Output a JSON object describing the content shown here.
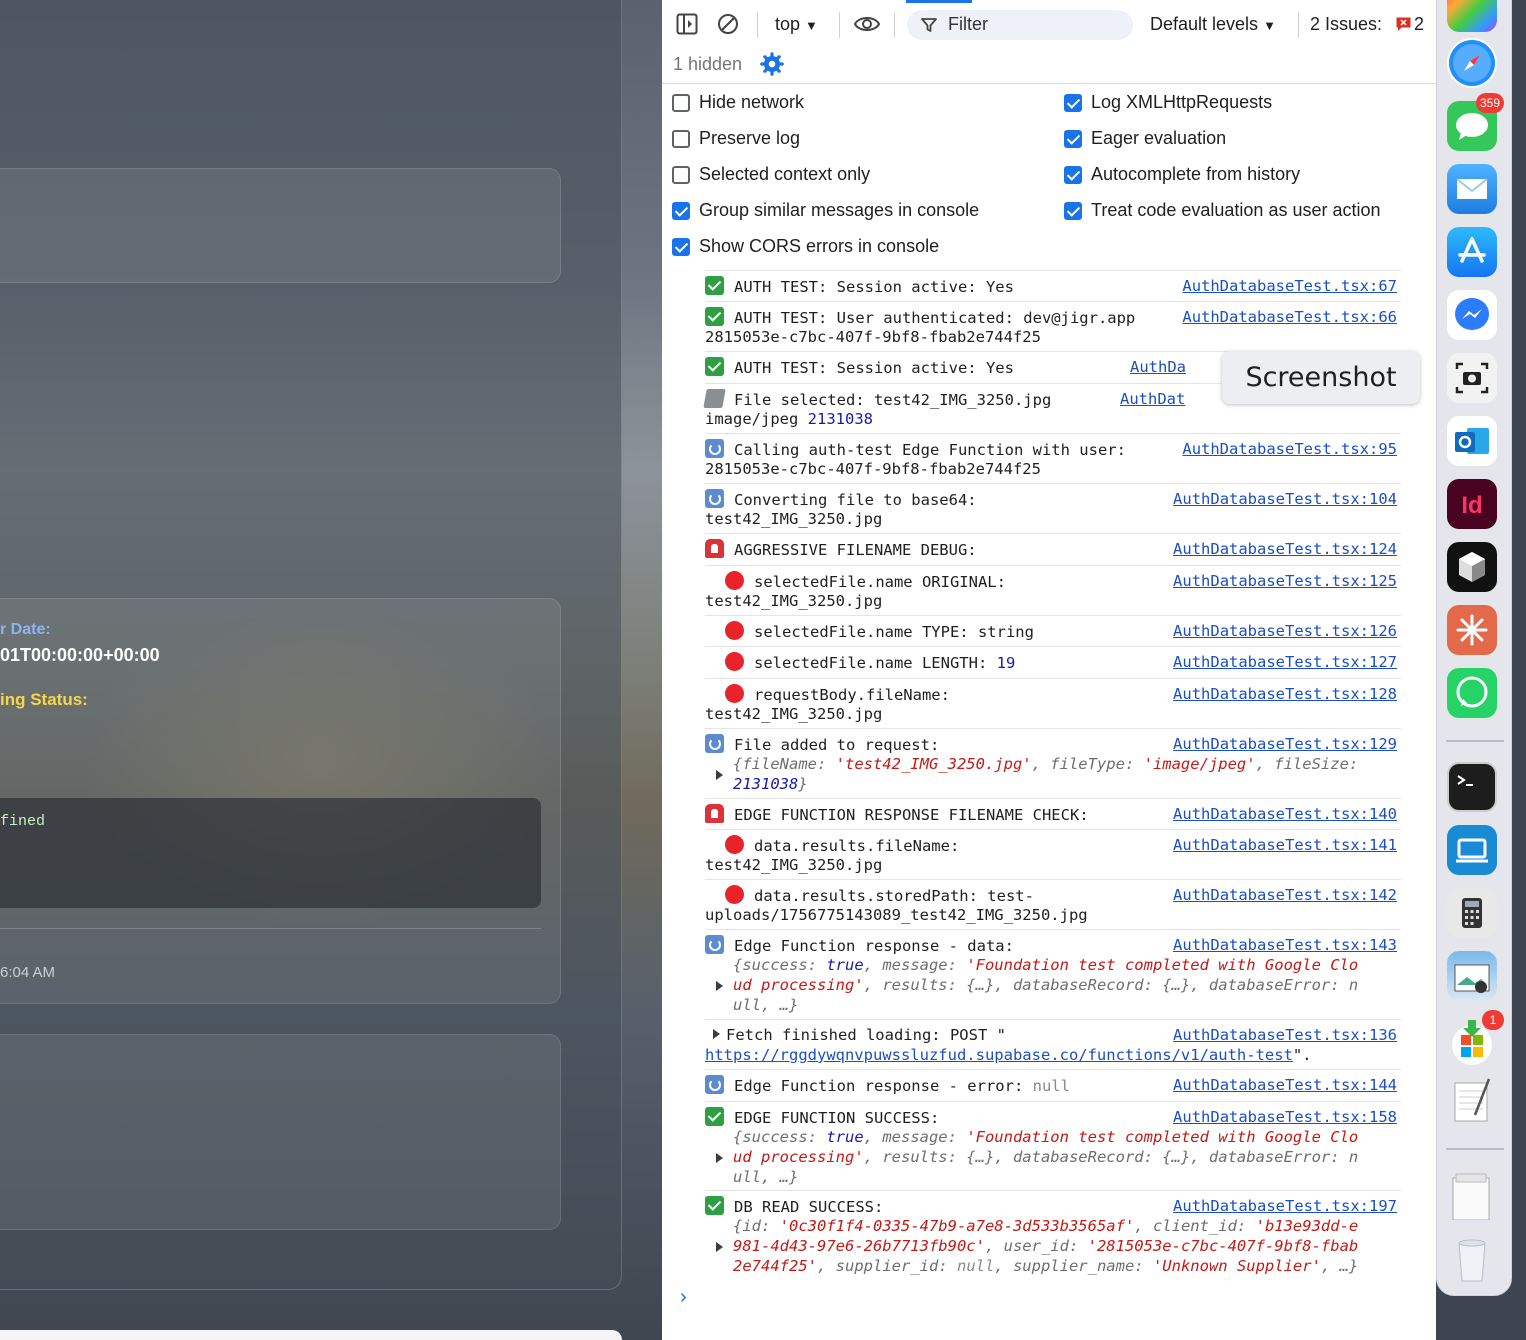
{
  "app": {
    "date_label": "r Date:",
    "date_value": "01T00:00:00+00:00",
    "status_label": "ing Status:",
    "code_snippet": "fined",
    "timestamp": "6:04 AM"
  },
  "devtools": {
    "toolbar": {
      "context": "top",
      "filter_placeholder": "Filter",
      "levels": "Default levels",
      "issues_label": "2 Issues:",
      "issues_count": "2"
    },
    "hidden_count": "1 hidden",
    "settings": {
      "left": [
        {
          "label": "Hide network",
          "checked": false
        },
        {
          "label": "Preserve log",
          "checked": false
        },
        {
          "label": "Selected context only",
          "checked": false
        },
        {
          "label": "Group similar messages in console",
          "checked": true
        },
        {
          "label": "Show CORS errors in console",
          "checked": true
        }
      ],
      "right": [
        {
          "label": "Log XMLHttpRequests",
          "checked": true
        },
        {
          "label": "Eager evaluation",
          "checked": true
        },
        {
          "label": "Autocomplete from history",
          "checked": true
        },
        {
          "label": "Treat code evaluation as user action",
          "checked": true
        }
      ]
    },
    "messages": [
      {
        "text": "AUTH TEST: Session active: Yes",
        "source": "AuthDatabaseTest.tsx:67"
      },
      {
        "text": "AUTH TEST: User authenticated: dev@jigr.app",
        "text2": "2815053e-c7bc-407f-9bf8-fbab2e744f25",
        "source": "AuthDatabaseTest.tsx:66"
      },
      {
        "text": "AUTH TEST: Session active: Yes",
        "source": "AuthDa"
      },
      {
        "text": "File selected: test42_IMG_3250.jpg",
        "text2a": "image/jpeg ",
        "text2b": "2131038",
        "source": "AuthDat"
      },
      {
        "text": "Calling auth-test Edge Function with user:",
        "text2": "2815053e-c7bc-407f-9bf8-fbab2e744f25",
        "source": "AuthDatabaseTest.tsx:95"
      },
      {
        "text": "Converting file to base64:",
        "text2": "test42_IMG_3250.jpg",
        "source": "AuthDatabaseTest.tsx:104"
      },
      {
        "text": "AGGRESSIVE FILENAME DEBUG:",
        "source": "AuthDatabaseTest.tsx:124"
      },
      {
        "text": "selectedFile.name ORIGINAL:",
        "text2": "test42_IMG_3250.jpg",
        "source": "AuthDatabaseTest.tsx:125"
      },
      {
        "text": "selectedFile.name TYPE: string",
        "source": "AuthDatabaseTest.tsx:126"
      },
      {
        "text": "selectedFile.name LENGTH: ",
        "num": "19",
        "source": "AuthDatabaseTest.tsx:127"
      },
      {
        "text": "requestBody.fileName:",
        "text2": "test42_IMG_3250.jpg",
        "source": "AuthDatabaseTest.tsx:128"
      },
      {
        "text": "File added to request:",
        "source": "AuthDatabaseTest.tsx:129"
      },
      {
        "text": "EDGE FUNCTION RESPONSE FILENAME CHECK:",
        "source": "AuthDatabaseTest.tsx:140"
      },
      {
        "text": "data.results.fileName:",
        "text2": "test42_IMG_3250.jpg",
        "source": "AuthDatabaseTest.tsx:141"
      },
      {
        "text": "data.results.storedPath: test-",
        "text2": "uploads/1756775143089_test42_IMG_3250.jpg",
        "source": "AuthDatabaseTest.tsx:142"
      },
      {
        "text": "Edge Function response - data:",
        "source": "AuthDatabaseTest.tsx:143"
      },
      {
        "text": "Fetch finished loading: POST \"",
        "url": "https://rggdywqnvpuwssluzfud.supabase.co/functions/v1/auth-test",
        "tail": "\".",
        "source": "AuthDatabaseTest.tsx:136"
      },
      {
        "text": "Edge Function response - error: ",
        "nul": "null",
        "source": "AuthDatabaseTest.tsx:144"
      },
      {
        "text": "EDGE FUNCTION SUCCESS:",
        "source": "AuthDatabaseTest.tsx:158"
      },
      {
        "text": "DB READ SUCCESS:",
        "source": "AuthDatabaseTest.tsx:197"
      }
    ],
    "obj_file_added": {
      "k1": "{fileName: ",
      "v1": "'test42_IMG_3250.jpg'",
      "k2": ", fileType: ",
      "v2": "'image/jpeg'",
      "k3": ", fileSize:",
      "v3": "2131038",
      "end": "}"
    },
    "obj_response": {
      "l1a": "{success: ",
      "l1b": "true",
      "l1c": ", message: ",
      "l1d": "'Foundation test completed with Google Clo",
      "l2a": "ud processing'",
      "l2b": ", results: {…}, databaseRecord: {…}, databaseError: n",
      "l3": "ull, …}"
    },
    "obj_db": {
      "l1a": "{id: ",
      "l1b": "'0c30f1f4-0335-47b9-a7e8-3d533b3565af'",
      "l1c": ", client_id: ",
      "l1d": "'b13e93dd-e",
      "l2a": "981-4d43-97e6-26b7713fb90c'",
      "l2b": ", user_id: ",
      "l2c": "'2815053e-c7bc-407f-9bf8-fbab",
      "l3a": "2e744f25'",
      "l3b": ", supplier_id: ",
      "l3c": "null",
      "l3d": ", supplier_name: ",
      "l3e": "'Unknown Supplier'",
      "l3f": ", …}"
    },
    "tooltip": "Screenshot"
  },
  "dock": {
    "messages_badge": "359",
    "store_badge": "1"
  }
}
